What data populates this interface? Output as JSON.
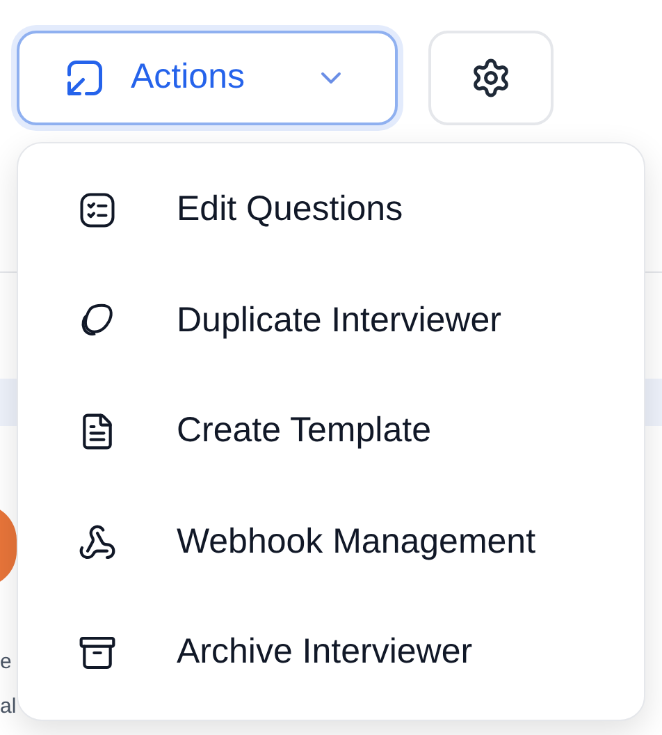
{
  "actions_button": {
    "label": "Actions",
    "expanded": true
  },
  "menu": {
    "items": [
      {
        "label": "Edit Questions"
      },
      {
        "label": "Duplicate Interviewer"
      },
      {
        "label": "Create Template"
      },
      {
        "label": "Webhook Management"
      },
      {
        "label": "Archive Interviewer"
      }
    ]
  },
  "background": {
    "fragments": [
      "e",
      "al"
    ]
  }
}
